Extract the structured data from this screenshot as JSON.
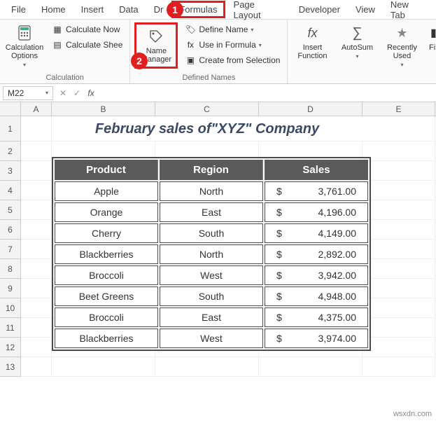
{
  "tabs": {
    "file": "File",
    "home": "Home",
    "insert": "Insert",
    "data": "Data",
    "draw_partial": "Dr",
    "formulas": "Formulas",
    "page_layout": "Page Layout",
    "developer": "Developer",
    "view": "View",
    "new_tab": "New Tab"
  },
  "ribbon": {
    "calc_options": "Calculation Options",
    "calculate_now": "Calculate Now",
    "calculate_sheet": "Calculate Shee",
    "calc_group": "Calculation",
    "name_manager": "Name Manager",
    "define_name": "Define Name",
    "use_in_formula": "Use in Formula",
    "create_from_sel": "Create from Selection",
    "defined_names_group": "Defined Names",
    "insert_function": "Insert Function",
    "autosum": "AutoSum",
    "recently_used": "Recently Used",
    "fin_partial": "Fir"
  },
  "annotations": {
    "one": "1",
    "two": "2"
  },
  "name_box": "M22",
  "fx_label": "fx",
  "columns": {
    "A": "A",
    "B": "B",
    "C": "C",
    "D": "D",
    "E": "E"
  },
  "row_nums": [
    "1",
    "2",
    "3",
    "4",
    "5",
    "6",
    "7",
    "8",
    "9",
    "10",
    "11",
    "12",
    "13"
  ],
  "title": "February sales of\"XYZ\" Company",
  "headers": {
    "product": "Product",
    "region": "Region",
    "sales": "Sales"
  },
  "currency": "$",
  "rows_data": [
    {
      "product": "Apple",
      "region": "North",
      "sales": "3,761.00"
    },
    {
      "product": "Orange",
      "region": "East",
      "sales": "4,196.00"
    },
    {
      "product": "Cherry",
      "region": "South",
      "sales": "4,149.00"
    },
    {
      "product": "Blackberries",
      "region": "North",
      "sales": "2,892.00"
    },
    {
      "product": "Broccoli",
      "region": "West",
      "sales": "3,942.00"
    },
    {
      "product": "Beet Greens",
      "region": "South",
      "sales": "4,948.00"
    },
    {
      "product": "Broccoli",
      "region": "East",
      "sales": "4,375.00"
    },
    {
      "product": "Blackberries",
      "region": "West",
      "sales": "3,974.00"
    }
  ],
  "watermark": "wsxdn.com",
  "chart_data": {
    "type": "table",
    "title": "February sales of \"XYZ\" Company",
    "columns": [
      "Product",
      "Region",
      "Sales"
    ],
    "rows": [
      [
        "Apple",
        "North",
        3761.0
      ],
      [
        "Orange",
        "East",
        4196.0
      ],
      [
        "Cherry",
        "South",
        4149.0
      ],
      [
        "Blackberries",
        "North",
        2892.0
      ],
      [
        "Broccoli",
        "West",
        3942.0
      ],
      [
        "Beet Greens",
        "South",
        4948.0
      ],
      [
        "Broccoli",
        "East",
        4375.0
      ],
      [
        "Blackberries",
        "West",
        3974.0
      ]
    ]
  }
}
